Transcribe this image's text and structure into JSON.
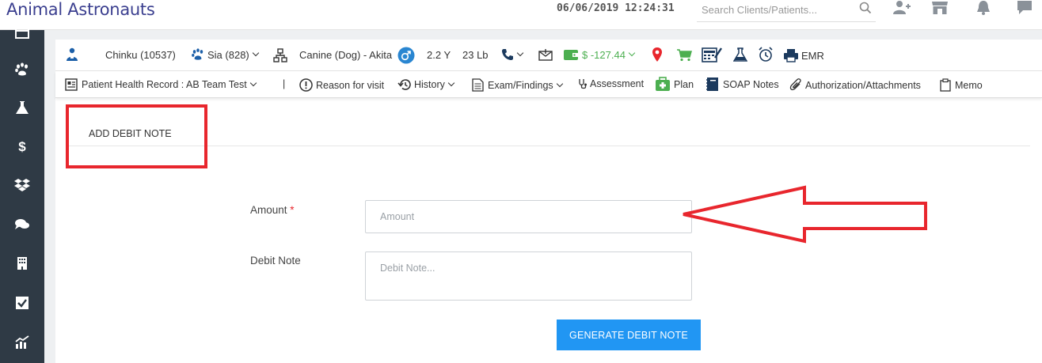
{
  "app": {
    "title": "Animal Astronauts"
  },
  "header": {
    "datetime": "06/06/2019 12:24:31",
    "search": {
      "placeholder": "Search Clients/Patients..."
    },
    "icons": [
      "add-user-icon",
      "store-icon",
      "bell-icon",
      "chat-icon"
    ]
  },
  "sidebar": {
    "items": [
      "calendar-icon",
      "paw-icon",
      "flask-icon",
      "dollar-icon",
      "dropbox-icon",
      "comments-icon",
      "building-icon",
      "checkbox-icon",
      "chart-icon"
    ]
  },
  "patient_bar": {
    "client": "Chinku (10537)",
    "patient": "Sia (828)",
    "species": "Canine (Dog) - Akita",
    "age": "2.2 Y",
    "weight": "23 Lb",
    "balance": "$ -127.44",
    "emr": "EMR"
  },
  "nav": {
    "record": "Patient Health Record : AB Team Test",
    "separator": "|",
    "reason": "Reason for visit",
    "history": "History",
    "exam": "Exam/Findings",
    "assessment": "Assessment",
    "plan": "Plan",
    "soap": "SOAP Notes",
    "auth": "Authorization/Attachments",
    "memo": "Memo"
  },
  "form": {
    "title": "ADD DEBIT NOTE",
    "amount_label": "Amount",
    "required_mark": "*",
    "amount_placeholder": "Amount",
    "amount_value": "",
    "note_label": "Debit Note",
    "note_placeholder": "Debit Note...",
    "note_value": "",
    "submit": "GENERATE DEBIT NOTE"
  },
  "colors": {
    "brand": "#3b3f8f",
    "sidebar": "#2f3a45",
    "primary_button": "#2196f3",
    "annotation": "#e8262d",
    "balance": "#4caf50"
  }
}
